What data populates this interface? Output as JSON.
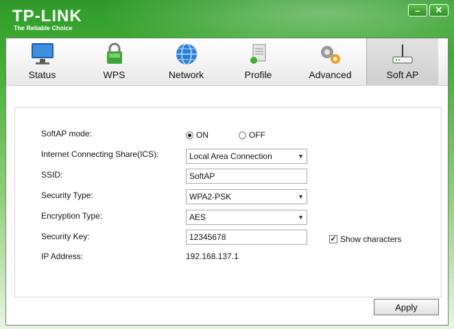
{
  "brand": {
    "name": "TP-LINK",
    "tagline": "The Reliable Choice"
  },
  "window_controls": {
    "minimize": "–",
    "close": "✕"
  },
  "tabs": [
    {
      "label": "Status",
      "icon": "monitor-icon"
    },
    {
      "label": "WPS",
      "icon": "wps-lock-icon"
    },
    {
      "label": "Network",
      "icon": "globe-icon"
    },
    {
      "label": "Profile",
      "icon": "profile-icon"
    },
    {
      "label": "Advanced",
      "icon": "gears-icon"
    },
    {
      "label": "Soft AP",
      "icon": "router-icon",
      "active": true
    }
  ],
  "form": {
    "softap_mode": {
      "label": "SoftAP mode:",
      "on": "ON",
      "off": "OFF",
      "selected": "ON"
    },
    "ics": {
      "label": "Internet Connecting Share(ICS):",
      "value": "Local Area Connection"
    },
    "ssid": {
      "label": "SSID:",
      "value": "SoftAP"
    },
    "security_type": {
      "label": "Security Type:",
      "value": "WPA2-PSK"
    },
    "encryption_type": {
      "label": "Encryption Type:",
      "value": "AES"
    },
    "security_key": {
      "label": "Security Key:",
      "value": "12345678"
    },
    "show_characters": {
      "label": "Show characters",
      "checked": true
    },
    "ip_address": {
      "label": "IP Address:",
      "value": "192.168.137.1"
    }
  },
  "apply_label": "Apply",
  "colors": {
    "brand_green": "#3fae32"
  }
}
